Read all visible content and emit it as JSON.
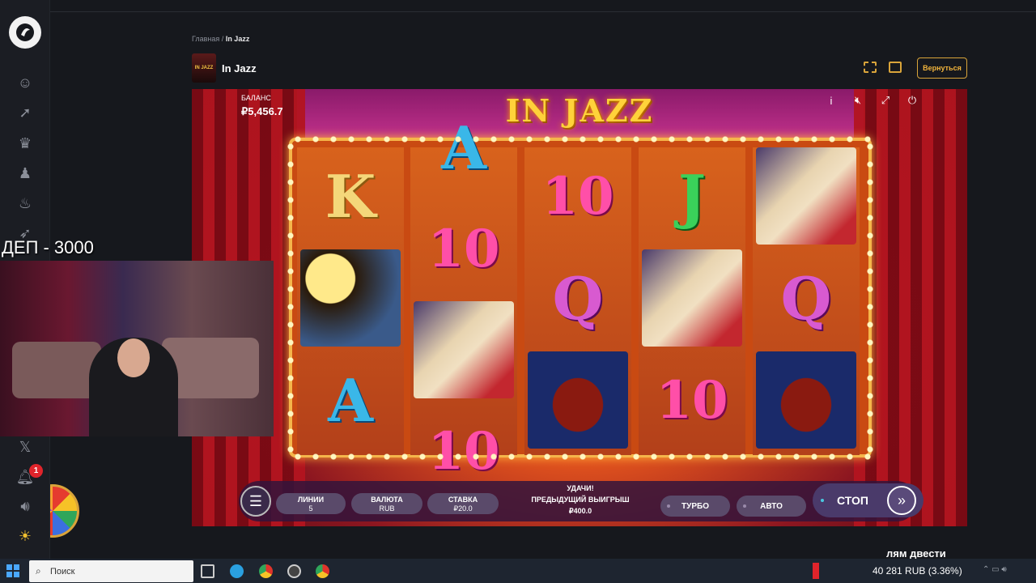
{
  "breadcrumb": {
    "home": "Главная",
    "sep": "/",
    "current": "In Jazz"
  },
  "game": {
    "title": "In Jazz",
    "thumb_text": "IN JAZZ",
    "logo": "IN JAZZ"
  },
  "header": {
    "back_label": "Вернуться"
  },
  "balance": {
    "label": "БАЛАНС",
    "value": "₽5,456.7"
  },
  "controls": {
    "lines_label": "ЛИНИИ",
    "lines_value": "5",
    "currency_label": "ВАЛЮТА",
    "currency_value": "RUB",
    "bet_label": "СТАВКА",
    "bet_value": "₽20.0",
    "luck": "УДАЧИ!",
    "prev_win_label": "ПРЕДЫДУЩИЙ ВЫИГРЫШ",
    "prev_win_value": "₽400.0",
    "turbo": "ТУРБО",
    "auto": "АВТО",
    "stop": "СТОП"
  },
  "reels": [
    [
      "K",
      "sax-player",
      "A"
    ],
    [
      "A",
      "10",
      "blonde-singer",
      "10"
    ],
    [
      "10",
      "Q",
      "cello"
    ],
    [
      "J",
      "blonde-singer",
      "10"
    ],
    [
      "blonde-singer",
      "Q",
      "cello"
    ]
  ],
  "stream": {
    "dep_label": "ДЕП - 3000",
    "bottom_text": "лям двести"
  },
  "sidebar": {
    "notification_count": "1"
  },
  "taskbar": {
    "search_placeholder": "Поиск",
    "ticker": "40 281 RUB (3.36%)"
  },
  "colors": {
    "accent": "#d9a43a",
    "taskbar": "#1e2530",
    "notification": "#e0242b"
  }
}
